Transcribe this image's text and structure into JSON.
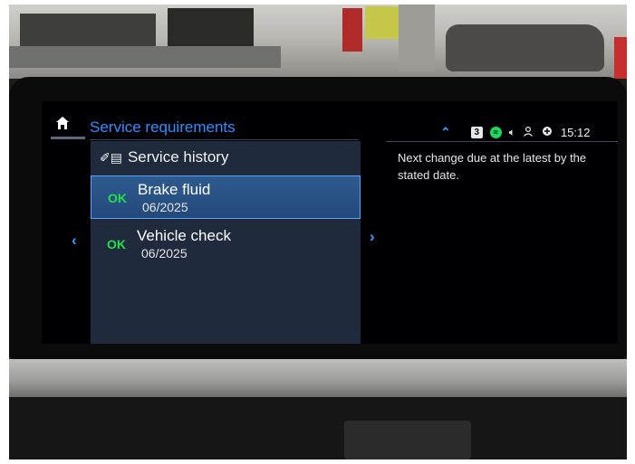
{
  "header": {
    "title": "Service requirements"
  },
  "status_bar": {
    "badge": "3",
    "time": "15:12"
  },
  "panel": {
    "header_label": "Service history",
    "items": [
      {
        "status": "OK",
        "title": "Brake fluid",
        "date": "06/2025"
      },
      {
        "status": "OK",
        "title": "Vehicle check",
        "date": "06/2025"
      }
    ]
  },
  "info": {
    "text": "Next change due at the latest by the stated date."
  },
  "icons": {
    "home": "home-icon",
    "history": "service-history-icon",
    "chevron_up": "chevron-up-icon",
    "spotify": "spotify-icon",
    "volume": "volume-icon",
    "profile": "profile-icon",
    "connectivity": "connectivity-icon",
    "arrow_left": "chevron-left-icon",
    "arrow_right": "chevron-right-icon"
  },
  "colors": {
    "accent": "#2f8fff",
    "ok": "#22e04a",
    "panel": "#1f2a3d",
    "selected": "#2e5a8e"
  }
}
